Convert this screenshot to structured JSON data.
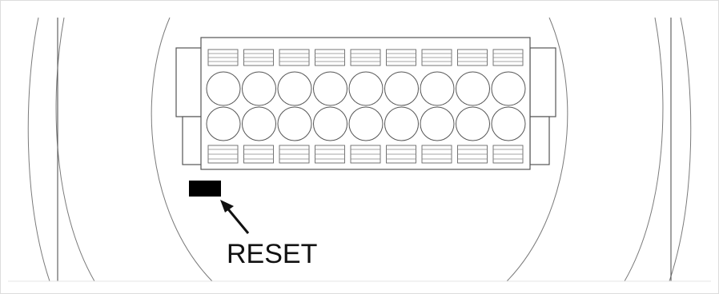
{
  "diagram": {
    "reset_label": "RESET",
    "reset_button_color": "#000000",
    "terminal_columns": 9,
    "terminal_rows": 2
  }
}
